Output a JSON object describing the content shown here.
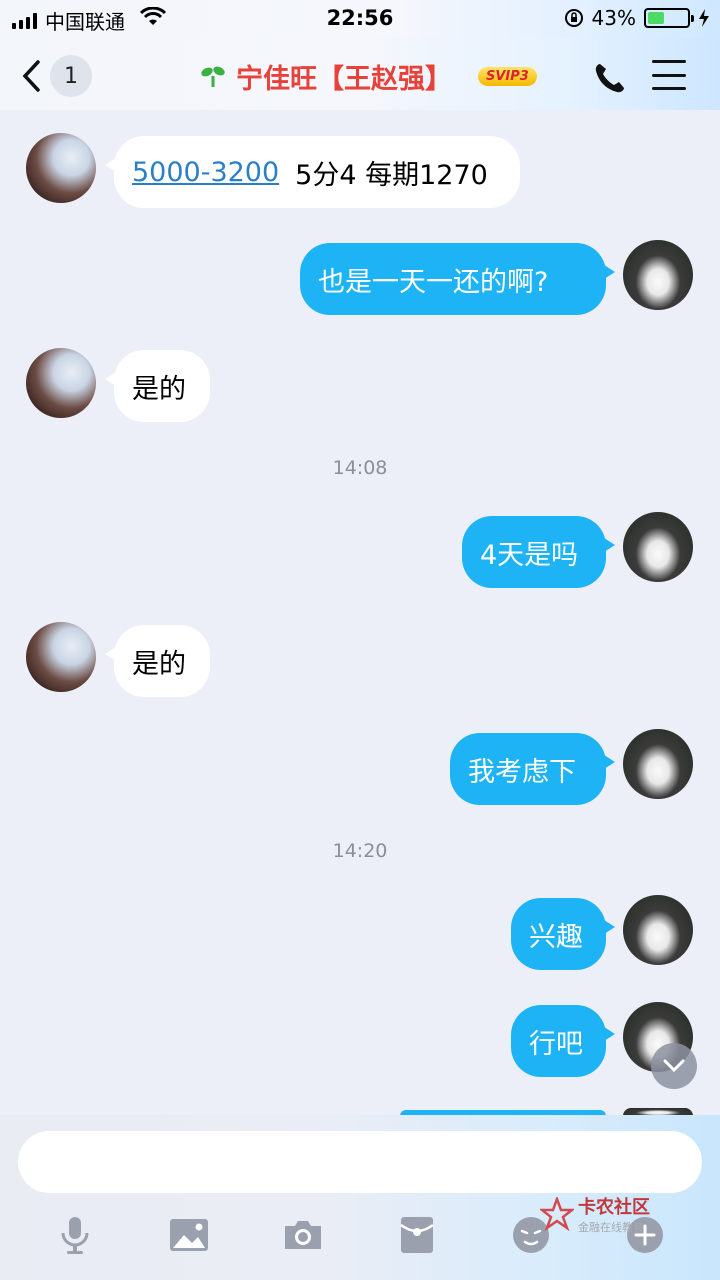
{
  "status_bar": {
    "carrier": "中国联通",
    "time": "22:56",
    "battery_percent": "43%",
    "battery_level": 0.43
  },
  "nav": {
    "back_count": "1",
    "title": "宁佳旺【王赵强】",
    "vip_badge": "SVIP3"
  },
  "messages": [
    {
      "side": "left",
      "link": "5000-3200",
      "text": "5分4 每期1270"
    },
    {
      "side": "right",
      "text": "也是一天一还的啊?"
    },
    {
      "side": "left",
      "text": "是的"
    },
    {
      "type": "time",
      "text": "14:08"
    },
    {
      "side": "right",
      "text": "4天是吗"
    },
    {
      "side": "left",
      "text": "是的"
    },
    {
      "side": "right",
      "text": "我考虑下"
    },
    {
      "type": "time",
      "text": "14:20"
    },
    {
      "side": "right",
      "text": "兴趣"
    },
    {
      "side": "right",
      "text": "行吧"
    }
  ],
  "input": {
    "placeholder": ""
  },
  "toolbar": [
    "mic-icon",
    "image-icon",
    "camera-icon",
    "red-packet-icon",
    "emoji-icon",
    "plus-icon"
  ],
  "watermark": {
    "title": "卡农社区",
    "subtitle": "金融在线教育"
  },
  "colors": {
    "accent": "#1eb3f5",
    "title": "#e8413a",
    "background": "#eceff7"
  }
}
